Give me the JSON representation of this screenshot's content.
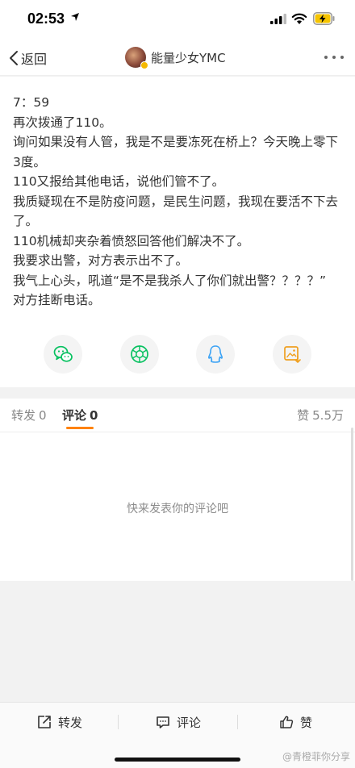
{
  "status_bar": {
    "time": "02:53"
  },
  "nav": {
    "back_label": "返回",
    "username": "能量少女YMC"
  },
  "post": {
    "lines": [
      "7：59",
      "再次拨通了110。",
      "询问如果没有人管，我是不是要冻死在桥上？今天晚上零下3度。",
      "110又报给其他电话，说他们管不了。",
      "我质疑现在不是防疫问题，是民生问题，我现在要活不下去了。",
      "110机械却夹杂着愤怒回答他们解决不了。",
      "我要求出警，对方表示出不了。",
      "我气上心头，吼道“是不是我杀人了你们就出警？？？？”",
      "对方挂断电话。"
    ]
  },
  "share": {
    "icons": [
      "wechat-icon",
      "moments-icon",
      "qq-icon",
      "save-image-icon"
    ],
    "colors": {
      "wechat": "#07c160",
      "moments": "#07c160",
      "qq": "#3aa2f5",
      "save": "#f0a020"
    }
  },
  "tabs": {
    "repost_label": "转发",
    "repost_count": "0",
    "comment_label": "评论",
    "comment_count": "0",
    "likes_label": "赞",
    "likes_count": "5.5万",
    "active": "评论",
    "accent": "#ff8200"
  },
  "comments": {
    "empty_text": "快来发表你的评论吧"
  },
  "toolbar": {
    "repost_label": "转发",
    "comment_label": "评论",
    "like_label": "赞"
  },
  "watermark": "@青橙菲你分享"
}
